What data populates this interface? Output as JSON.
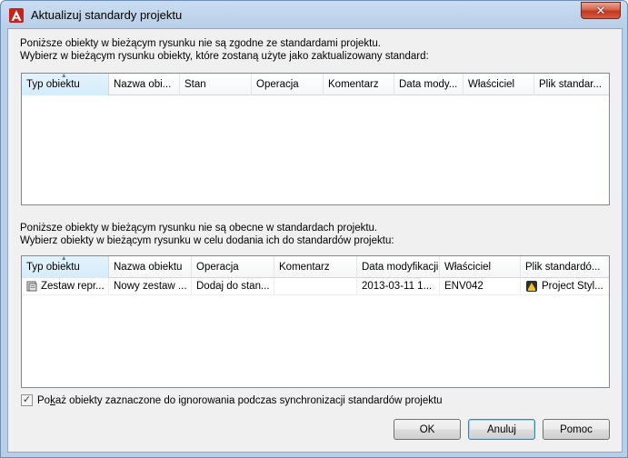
{
  "window": {
    "title": "Aktualizuj standardy projektu",
    "close_label": "✕"
  },
  "section1": {
    "line1": "Poniższe obiekty w bieżącym rysunku nie są zgodne ze standardami projektu.",
    "line2": "Wybierz w bieżącym rysunku obiekty, które zostaną użyte jako zaktualizowany standard:",
    "columns": [
      "Typ obiektu",
      "Nazwa obi...",
      "Stan",
      "Operacja",
      "Komentarz",
      "Data mody...",
      "Właściciel",
      "Plik standar..."
    ]
  },
  "section2": {
    "line1": "Poniższe obiekty w bieżącym rysunku nie są obecne w standardach projektu.",
    "line2": "Wybierz obiekty w bieżącym rysunku w celu dodania ich do standardów projektu:",
    "columns": [
      "Typ obiektu",
      "Nazwa obiektu",
      "Operacja",
      "Komentarz",
      "Data modyfikacji",
      "Właściciel",
      "Plik standardó..."
    ],
    "rows": [
      {
        "type": "Zestaw repr...",
        "name": "Nowy zestaw ...",
        "operation": "Dodaj do stan...",
        "comment": "",
        "modified": "2013-03-11 1...",
        "owner": "ENV042",
        "file": "Project Styl..."
      }
    ]
  },
  "checkbox": {
    "checked": true,
    "label_pre": "Po",
    "label_underline": "k",
    "label_post": "aż obiekty zaznaczone do ignorowania podczas synchronizacji standardów projektu"
  },
  "buttons": {
    "ok": "OK",
    "cancel": "Anuluj",
    "help": "Pomoc"
  }
}
